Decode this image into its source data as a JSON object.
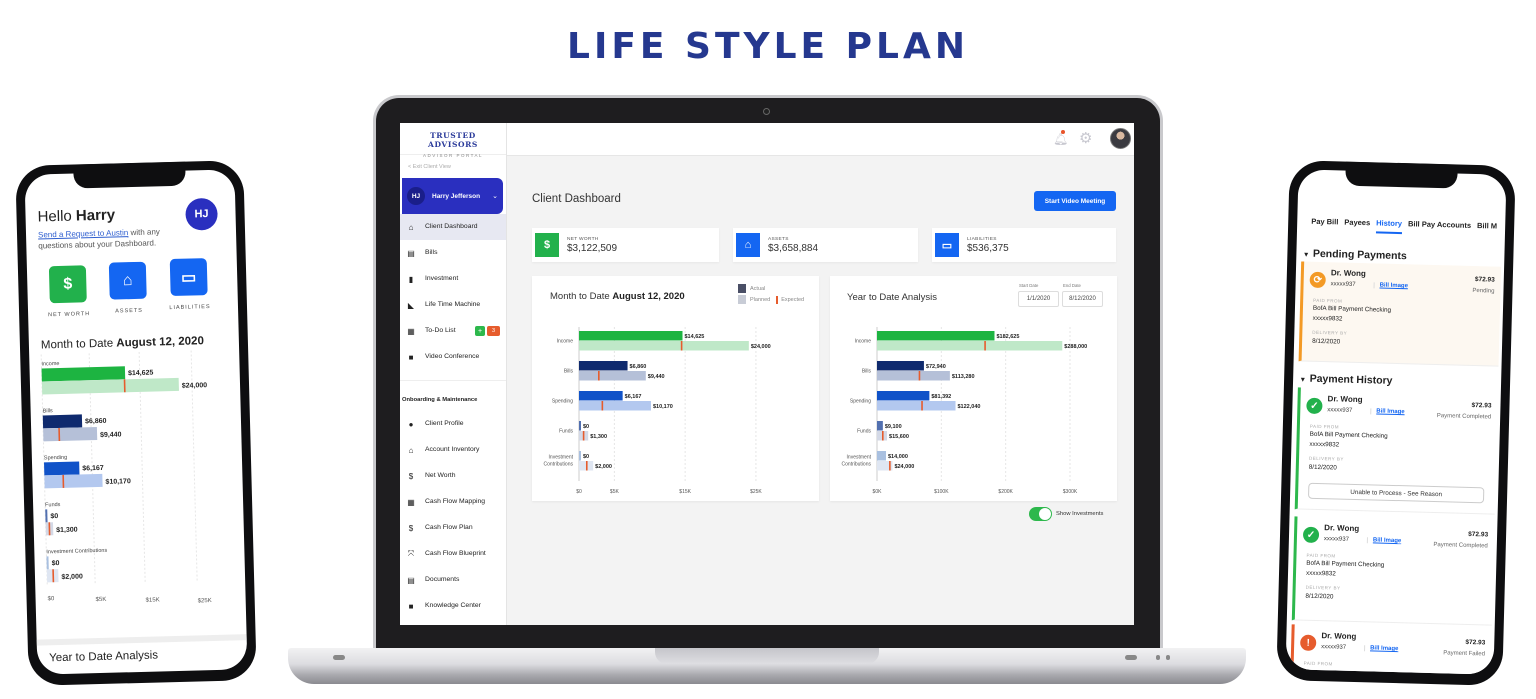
{
  "headline": "LIFE STYLE PLAN",
  "laptop": {
    "sidebar": {
      "brand_title": "TRUSTED ADVISORS",
      "brand_subtitle": "ADVISOR PORTAL",
      "exit_label": "< Exit Client View",
      "client": {
        "initials": "HJ",
        "name": "Harry Jefferson"
      },
      "items": [
        {
          "label": "Client Dashboard",
          "icon": "home-icon",
          "glyph": "⌂",
          "active": true
        },
        {
          "label": "Bills",
          "icon": "bill-icon",
          "glyph": "▤"
        },
        {
          "label": "Investment",
          "icon": "bar-chart-icon",
          "glyph": "▮"
        },
        {
          "label": "Life Time Machine",
          "icon": "area-chart-icon",
          "glyph": "◣"
        },
        {
          "label": "To-Do List",
          "icon": "checklist-icon",
          "glyph": "▦",
          "add_badge": "+",
          "count_badge": "3"
        },
        {
          "label": "Video Conference",
          "icon": "video-icon",
          "glyph": "■"
        }
      ],
      "section_title": "Onboarding & Maintenance",
      "section_items": [
        {
          "label": "Client Profile",
          "icon": "user-circle-icon",
          "glyph": "●"
        },
        {
          "label": "Account Inventory",
          "icon": "bank-icon",
          "glyph": "⌂"
        },
        {
          "label": "Net Worth",
          "icon": "dollar-circle-icon",
          "glyph": "$"
        },
        {
          "label": "Cash Flow Mapping",
          "icon": "grid-icon",
          "glyph": "▦"
        },
        {
          "label": "Cash Flow Plan",
          "icon": "money-flow-icon",
          "glyph": "$"
        },
        {
          "label": "Cash Flow Blueprint",
          "icon": "blueprint-icon",
          "glyph": "⤧"
        },
        {
          "label": "Documents",
          "icon": "documents-icon",
          "glyph": "▤"
        },
        {
          "label": "Knowledge Center",
          "icon": "book-icon",
          "glyph": "■"
        }
      ]
    },
    "main": {
      "title": "Client Dashboard",
      "video_button": "Start Video Meeting",
      "kpis": [
        {
          "label": "NET WORTH",
          "value": "$3,122,509",
          "icon": "dollar-icon",
          "color": "#22b14c"
        },
        {
          "label": "ASSETS",
          "value": "$3,658,884",
          "icon": "home-icon",
          "color": "#1466f2"
        },
        {
          "label": "LIABILITIES",
          "value": "$536,375",
          "icon": "credit-card-icon",
          "color": "#1466f2"
        }
      ],
      "mtd_title_prefix": "Month to Date",
      "mtd_title_date": "August 12, 2020",
      "legend": {
        "actual": "Actual",
        "planned": "Planned",
        "expected": "Expected"
      },
      "ytd_title": "Year to Date Analysis",
      "start_date_label": "Start Date",
      "start_date": "1/1/2020",
      "end_date_label": "End Date",
      "end_date": "8/12/2020",
      "toggle_label": "Show Investments",
      "toggle_on": true
    }
  },
  "chart_data": [
    {
      "type": "bar",
      "title": "Month to Date August 12, 2020",
      "categories": [
        "Income",
        "Bills",
        "Spending",
        "Funds",
        "Investment Contributions"
      ],
      "series": [
        {
          "name": "Actual",
          "values": [
            14625,
            6860,
            6167,
            0,
            0
          ],
          "labels": [
            "$14,625",
            "$6,860",
            "$6,167",
            "$0",
            "$0"
          ]
        },
        {
          "name": "Planned",
          "values": [
            24000,
            9440,
            10170,
            1300,
            2000
          ],
          "labels": [
            "$24,000",
            "$9,440",
            "$10,170",
            "$1,300",
            "$2,000"
          ]
        },
        {
          "name": "Expected",
          "values": [
            14500,
            2800,
            3300,
            650,
            1100
          ]
        }
      ],
      "xticks": [
        "$0",
        "$5K",
        "$15K",
        "$25K"
      ],
      "xlim": [
        0,
        30000
      ],
      "tick_values": [
        0,
        5000,
        15000,
        25000
      ],
      "colors": {
        "actual": [
          "#1db441",
          "#0f2a6e",
          "#1052c8",
          "#5270b0",
          "#a9c0e0"
        ],
        "planned": [
          "#bfe8c8",
          "#b5c0d8",
          "#b3c8ef",
          "#d4d9e6",
          "#dfe6f2"
        ],
        "expected": "#e65c2d"
      }
    },
    {
      "type": "bar",
      "title": "Year to Date Analysis",
      "categories": [
        "Income",
        "Bills",
        "Spending",
        "Funds",
        "Investment Contributions"
      ],
      "series": [
        {
          "name": "Actual",
          "values": [
            182625,
            72940,
            81392,
            9100,
            14000
          ],
          "labels": [
            "$182,625",
            "$72,940",
            "$81,392",
            "$9,100",
            "$14,000"
          ]
        },
        {
          "name": "Planned",
          "values": [
            288000,
            113280,
            122040,
            15600,
            24000
          ],
          "labels": [
            "$288,000",
            "$113,280",
            "$122,040",
            "$15,600",
            "$24,000"
          ]
        },
        {
          "name": "Expected",
          "values": [
            168000,
            66000,
            70000,
            9000,
            20000
          ]
        }
      ],
      "xticks": [
        "$0K",
        "$100K",
        "$200K",
        "$300K"
      ],
      "xlim": [
        0,
        330000
      ],
      "tick_values": [
        0,
        100000,
        200000,
        300000
      ],
      "colors": {
        "actual": [
          "#1db441",
          "#0f2a6e",
          "#1052c8",
          "#5270b0",
          "#a9c0e0"
        ],
        "planned": [
          "#bfe8c8",
          "#b5c0d8",
          "#b3c8ef",
          "#d4d9e6",
          "#dfe6f2"
        ],
        "expected": "#e65c2d"
      }
    }
  ],
  "left_phone": {
    "greeting": "Hello",
    "name": "Harry",
    "request_link": "Send a Request to Austin",
    "request_rest": " with any questions about your Dashboard.",
    "initials": "HJ",
    "tiles": [
      {
        "label": "NET WORTH",
        "icon": "dollar-icon",
        "color": "#22b14c"
      },
      {
        "label": "ASSETS",
        "icon": "home-icon",
        "color": "#1466f2"
      },
      {
        "label": "LIABILITIES",
        "icon": "credit-card-icon",
        "color": "#1466f2"
      }
    ],
    "mtd_prefix": "Month to Date",
    "mtd_date": "August 12, 2020",
    "ytd_title": "Year to Date Analysis"
  },
  "right_phone": {
    "tabs": [
      "Pay Bill",
      "Payees",
      "History",
      "Bill Pay Accounts",
      "Bill M"
    ],
    "active_tab": "History",
    "pending_title": "Pending Payments",
    "history_title": "Payment History",
    "paid_from_label": "PAID FROM",
    "delivery_label": "DELIVERY BY",
    "payments": [
      {
        "payee": "Dr. Wong",
        "account": "xxxxx937",
        "bill_image": "Bill Image",
        "amount": "$72.93",
        "status": "Pending",
        "paid_from": "BofA Bill Payment Checking",
        "paid_acct": "xxxxx9832",
        "delivery": "8/12/2020"
      },
      {
        "payee": "Dr. Wong",
        "account": "xxxxx937",
        "bill_image": "Bill Image",
        "amount": "$72.93",
        "status": "Payment Completed",
        "paid_from": "BofA Bill Payment Checking",
        "paid_acct": "xxxxx9832",
        "delivery": "8/12/2020",
        "action": "Unable to Process - See Reason"
      },
      {
        "payee": "Dr. Wong",
        "account": "xxxxx937",
        "bill_image": "Bill Image",
        "amount": "$72.93",
        "status": "Payment Completed",
        "paid_from": "BofA Bill Payment Checking",
        "paid_acct": "xxxxx9832",
        "delivery": "8/12/2020"
      },
      {
        "payee": "Dr. Wong",
        "account": "xxxxx937",
        "bill_image": "Bill Image",
        "amount": "$72.93",
        "status": "Payment Failed"
      }
    ]
  }
}
